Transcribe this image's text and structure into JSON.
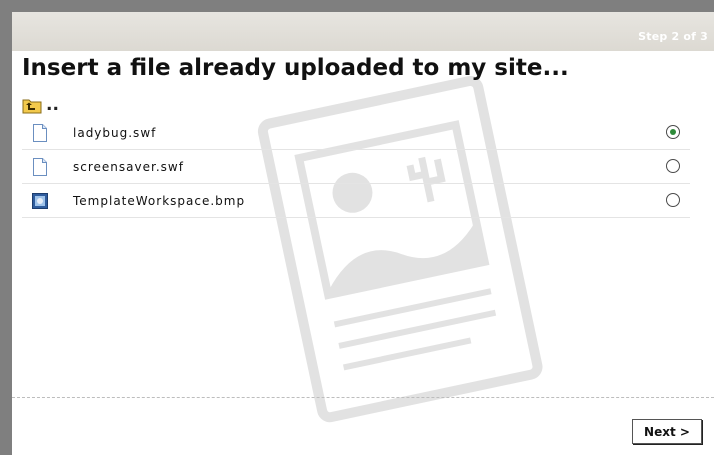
{
  "header": {
    "step_label": "Step 2 of 3",
    "title": "Insert a file already uploaded to my site..."
  },
  "parent_folder": {
    "icon": "folder-up-icon",
    "label": ".."
  },
  "files": [
    {
      "name": "ladybug.swf",
      "icon": "document-icon",
      "selected": true
    },
    {
      "name": "screensaver.swf",
      "icon": "document-icon",
      "selected": false
    },
    {
      "name": "TemplateWorkspace.bmp",
      "icon": "image-icon",
      "selected": false
    }
  ],
  "footer": {
    "next_label": "Next >"
  },
  "colors": {
    "frame": "#7f7f7f",
    "step_bar": "#dcd9d2",
    "radio_selected": "#2e8b3a"
  }
}
